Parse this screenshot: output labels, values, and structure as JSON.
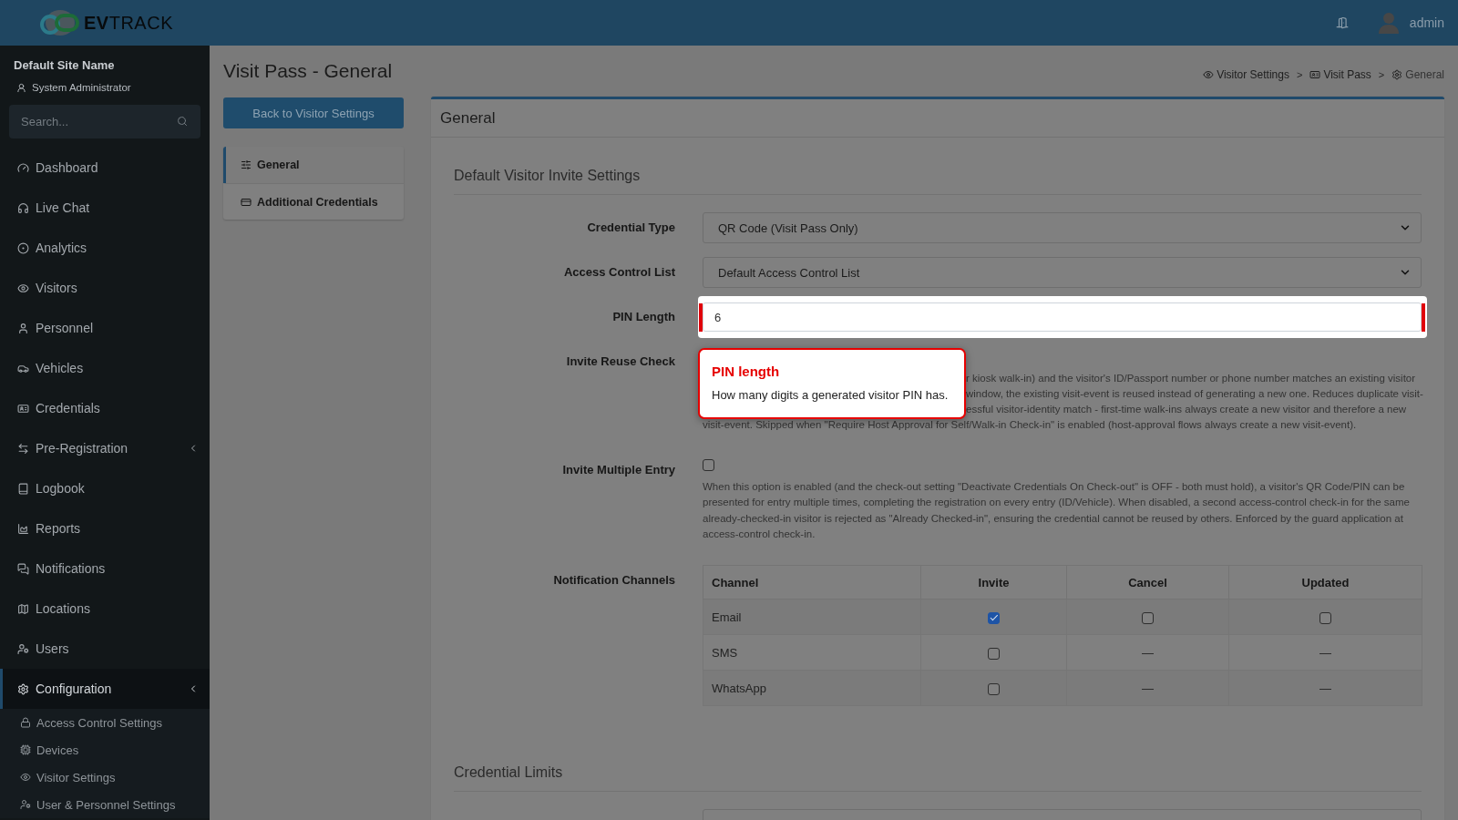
{
  "header": {
    "logo_text": "**EV**TRACK",
    "user_name": "admin"
  },
  "sidebar": {
    "site_name": "Default Site Name",
    "role": "System Administrator",
    "search": {
      "placeholder": "Search..."
    },
    "items": [
      {
        "label": "Dashboard",
        "selected": false,
        "expandable": false
      },
      {
        "label": "Live Chat",
        "selected": false,
        "expandable": false
      },
      {
        "label": "Analytics",
        "selected": false,
        "expandable": false
      },
      {
        "label": "Visitors",
        "selected": false,
        "expandable": false
      },
      {
        "label": "Personnel",
        "selected": false,
        "expandable": false
      },
      {
        "label": "Vehicles",
        "selected": false,
        "expandable": false
      },
      {
        "label": "Credentials",
        "selected": false,
        "expandable": false
      },
      {
        "label": "Pre-Registration",
        "selected": false,
        "expandable": true
      },
      {
        "label": "Logbook",
        "selected": false,
        "expandable": false
      },
      {
        "label": "Reports",
        "selected": false,
        "expandable": false
      },
      {
        "label": "Notifications",
        "selected": false,
        "expandable": false
      },
      {
        "label": "Locations",
        "selected": false,
        "expandable": false
      },
      {
        "label": "Users",
        "selected": false,
        "expandable": false
      },
      {
        "label": "Configuration",
        "selected": true,
        "expandable": true,
        "children": [
          {
            "label": "Access Control Settings",
            "selected": false
          },
          {
            "label": "Devices",
            "selected": false
          },
          {
            "label": "Visitor Settings",
            "selected": false
          },
          {
            "label": "User & Personnel Settings",
            "selected": false
          }
        ]
      }
    ]
  },
  "page": {
    "title": "Visit Pass - General",
    "breadcrumb": [
      {
        "label": "Visitor Settings",
        "current": false,
        "separator": ">"
      },
      {
        "label": "Visit Pass",
        "current": false,
        "separator": ">"
      },
      {
        "label": "General",
        "current": true
      }
    ]
  },
  "back_button": "Back to Visitor Settings",
  "nav_tabs": [
    {
      "label": "General",
      "selected": true
    },
    {
      "label": "Additional Credentials",
      "selected": false
    }
  ],
  "card": {
    "title": "General",
    "sections": [
      {
        "title": "Default Visitor Invite Settings",
        "rows": [
          {
            "kind": "select",
            "label": "Credential Type",
            "value": "QR Code (Visit Pass Only)"
          },
          {
            "kind": "select",
            "label": "Access Control List",
            "value": "Default Access Control List"
          },
          {
            "kind": "input",
            "label": "PIN Length",
            "value": "6",
            "highlighted": true
          },
          {
            "kind": "text",
            "label": "Invite Reuse Check",
            "description": [
              {
                "text": "r kiosk walk-in) and the visitor's ID/Passport number or phone number matches an existing visitor",
                "behind_tooltip": true
              },
              {
                "text": "window, the existing visit-event is reused instead of generating a new one. Reduces duplicate visit-",
                "behind_tooltip": true
              },
              {
                "text": "essful visitor-identity match - first-time walk-ins always create a new visitor and therefore a new",
                "behind_tooltip": true
              },
              {
                "text": "visit-event. Skipped when \"Require Host Approval for Self/Walk-in Check-in\" is enabled (host-approval flows always create a new visit-event).",
                "behind_tooltip": false
              }
            ]
          },
          {
            "kind": "checkbox",
            "label": "Invite Multiple Entry",
            "checked": false,
            "description": [
              {
                "text": "When this option is enabled (and the check-out setting \"Deactivate Credentials On Check-out\" is OFF - both must hold), a visitor's QR Code/PIN can be presented for entry multiple times, completing the registration on every entry (ID/Vehicle). When disabled, a second access-control check-in for the same already-checked-in visitor is rejected as \"Already Checked-in\", ensuring the credential cannot be reused by others. Enforced by the guard application at access-control check-in.",
                "behind_tooltip": false
              }
            ]
          },
          {
            "kind": "table",
            "label": "Notification Channels",
            "columns": [
              "Channel",
              "Invite",
              "Cancel",
              "Updated"
            ],
            "rows": [
              {
                "cells": [
                  {
                    "kind": "text",
                    "text": "Email"
                  },
                  {
                    "kind": "checkbox",
                    "checked": true
                  },
                  {
                    "kind": "checkbox",
                    "checked": false
                  },
                  {
                    "kind": "checkbox",
                    "checked": false
                  }
                ]
              },
              {
                "cells": [
                  {
                    "kind": "text",
                    "text": "SMS"
                  },
                  {
                    "kind": "checkbox",
                    "checked": false
                  },
                  {
                    "kind": "text",
                    "text": "—"
                  },
                  {
                    "kind": "text",
                    "text": "—"
                  }
                ]
              },
              {
                "cells": [
                  {
                    "kind": "text",
                    "text": "WhatsApp"
                  },
                  {
                    "kind": "checkbox",
                    "checked": false
                  },
                  {
                    "kind": "text",
                    "text": "—"
                  },
                  {
                    "kind": "text",
                    "text": "—"
                  }
                ]
              }
            ]
          }
        ]
      },
      {
        "title": "Credential Limits",
        "rows": [
          {
            "kind": "input",
            "highlighted": false
          }
        ]
      }
    ]
  },
  "tour_tooltip": {
    "title": "PIN length",
    "text": "How many digits a generated visitor PIN has."
  }
}
